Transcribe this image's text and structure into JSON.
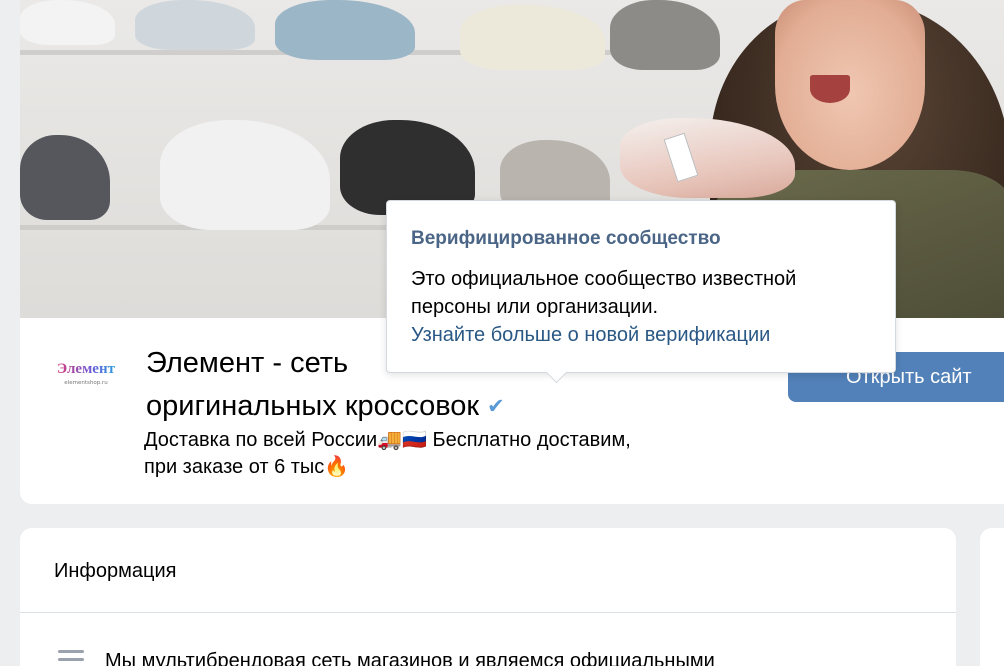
{
  "community": {
    "logo_text": "Элемент",
    "logo_url": "elementshop.ru",
    "title": "Элемент - сеть магазинов оригинальных кроссовок",
    "title_line1": "Элемент - сеть",
    "title_line2": "оригинальных кроссовок",
    "status_line1": "Доставка по всей России🚚🇷🇺 Бесплатно доставим,",
    "status_line2": "при заказе от 6 тыс🔥",
    "open_site_label": "Открыть сайт"
  },
  "tooltip": {
    "title": "Верифицированное сообщество",
    "text": "Это официальное сообщество известной персоны или организации.",
    "link": "Узнайте больше о новой верификации"
  },
  "info": {
    "heading": "Информация",
    "description": "Мы мультибрендовая сеть магазинов и являемся официальными"
  },
  "colors": {
    "accent": "#5181b8",
    "link": "#2a5885",
    "tooltip_title": "#4a6585",
    "verified": "#5a9ad6",
    "background": "#edeef0"
  },
  "icons": {
    "verified": "checkmark-icon",
    "info_menu": "menu-lines-icon"
  }
}
